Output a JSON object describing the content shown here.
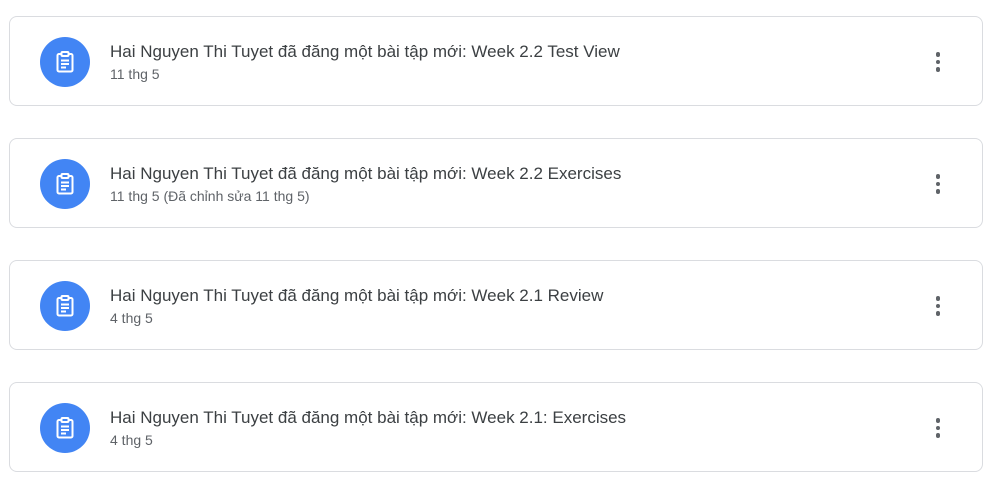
{
  "stream": {
    "posts": [
      {
        "icon": "assignment-icon",
        "title": "Hai Nguyen Thi Tuyet đã đăng một bài tập mới: Week 2.2 Test View",
        "date": "11 thg 5"
      },
      {
        "icon": "assignment-icon",
        "title": "Hai Nguyen Thi Tuyet đã đăng một bài tập mới: Week 2.2 Exercises",
        "date": "11 thg 5 (Đã chỉnh sửa 11 thg 5)"
      },
      {
        "icon": "assignment-icon",
        "title": "Hai Nguyen Thi Tuyet đã đăng một bài tập mới: Week 2.1 Review",
        "date": "4 thg 5"
      },
      {
        "icon": "assignment-icon",
        "title": "Hai Nguyen Thi Tuyet đã đăng một bài tập mới: Week 2.1: Exercises",
        "date": "4 thg 5"
      }
    ]
  },
  "colors": {
    "accent": "#4285f4",
    "border": "#dadce0",
    "title_text": "#3c4043",
    "secondary_text": "#5f6368"
  }
}
